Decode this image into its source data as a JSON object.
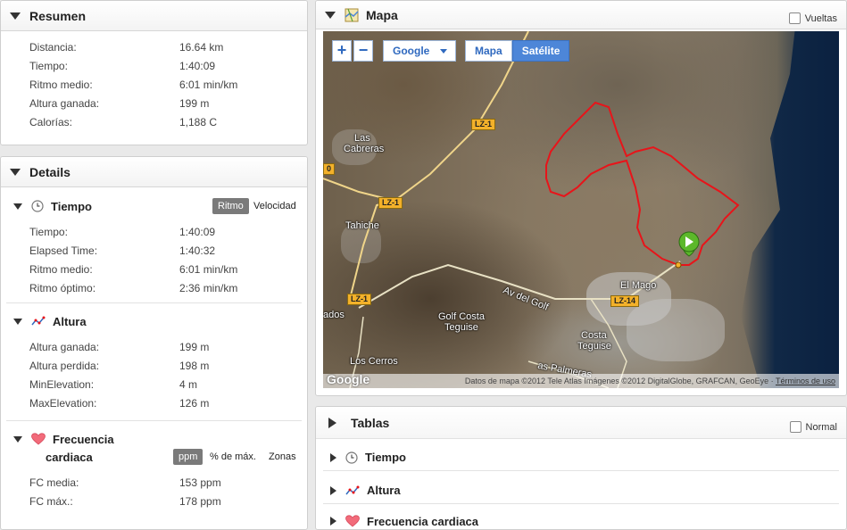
{
  "resumen": {
    "title": "Resumen",
    "rows": [
      {
        "label": "Distancia:",
        "value": "16.64 km"
      },
      {
        "label": "Tiempo:",
        "value": "1:40:09"
      },
      {
        "label": "Ritmo medio:",
        "value": "6:01 min/km"
      },
      {
        "label": "Altura ganada:",
        "value": "199 m"
      },
      {
        "label": "Calorías:",
        "value": "1,188 C"
      }
    ]
  },
  "details": {
    "title": "Details",
    "tiempo": {
      "title": "Tiempo",
      "toggle_active": "Ritmo",
      "toggle_other": "Velocidad",
      "rows": [
        {
          "label": "Tiempo:",
          "value": "1:40:09"
        },
        {
          "label": "Elapsed Time:",
          "value": "1:40:32"
        },
        {
          "label": "Ritmo medio:",
          "value": "6:01 min/km"
        },
        {
          "label": "Ritmo óptimo:",
          "value": "2:36 min/km"
        }
      ]
    },
    "altura": {
      "title": "Altura",
      "rows": [
        {
          "label": "Altura ganada:",
          "value": "199 m"
        },
        {
          "label": "Altura perdida:",
          "value": "198 m"
        },
        {
          "label": "MinElevation:",
          "value": "4 m"
        },
        {
          "label": "MaxElevation:",
          "value": "126 m"
        }
      ]
    },
    "frecuencia": {
      "title_line1": "Frecuencia",
      "title_line2": "cardiaca",
      "toggle_active": "ppm",
      "toggle_mid": "% de máx.",
      "toggle_other": "Zonas",
      "rows": [
        {
          "label": "FC media:",
          "value": "153 ppm"
        },
        {
          "label": "FC máx.:",
          "value": "178 ppm"
        }
      ]
    }
  },
  "mapa": {
    "title": "Mapa",
    "laps_label": "Vueltas",
    "zoom_in": "+",
    "zoom_out": "−",
    "provider": "Google",
    "type_map": "Mapa",
    "type_sat": "Satélite",
    "labels": {
      "las_cabreras_1": "Las",
      "las_cabreras_2": "Cabreras",
      "tahiche": "Tahiche",
      "golf_1": "Golf Costa",
      "golf_2": "Teguise",
      "el_mago": "El Mago",
      "costa_1": "Costa",
      "costa_2": "Teguise",
      "los_cerros": "Los Cerros",
      "av_golf": "Av del Golf",
      "las_palmeras": "as Palmeras",
      "ados": "ados",
      "zero": "0"
    },
    "roads": {
      "lz1": "LZ-1",
      "lz14": "LZ-14"
    },
    "logo": "Google",
    "attribution": "Datos de mapa ©2012 Tele Atlas Imágenes ©2012 DigitalGlobe, GRAFCAN, GeoEye · ",
    "terms": "Términos de uso"
  },
  "tablas": {
    "title": "Tablas",
    "normal_label": "Normal",
    "items": [
      {
        "label": "Tiempo"
      },
      {
        "label": "Altura"
      },
      {
        "label": "Frecuencia cardiaca"
      }
    ]
  },
  "colors": {
    "route": "#e8141a",
    "accent": "#4d86d8",
    "marker": "#5cb82a"
  }
}
